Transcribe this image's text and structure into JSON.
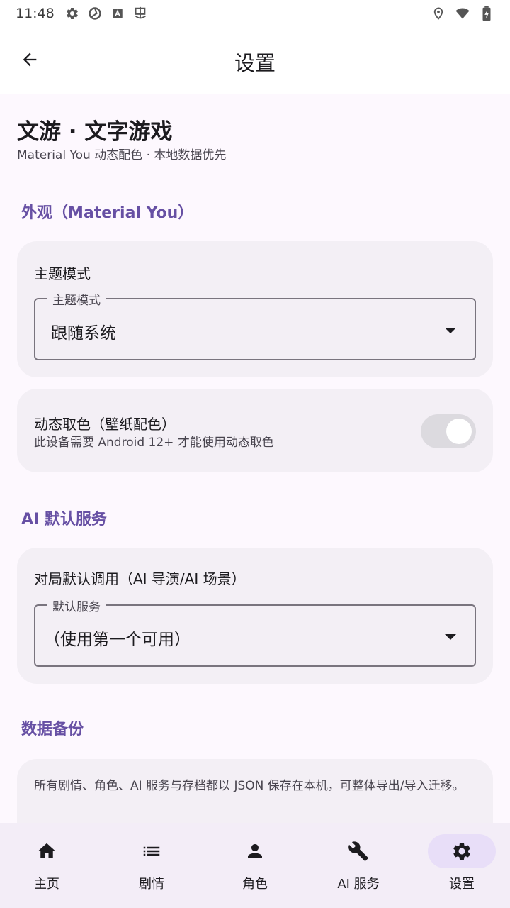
{
  "status_bar": {
    "time": "11:48",
    "left_icons": [
      "gear-icon",
      "aperture-icon",
      "a-box-icon",
      "bug-icon"
    ],
    "right_icons": [
      "location-icon",
      "wifi-icon",
      "battery-icon"
    ]
  },
  "app_bar": {
    "title": "设置"
  },
  "header": {
    "app_name": "文游 · 文字游戏",
    "subtitle": "Material You 动态配色 · 本地数据优先"
  },
  "sections": {
    "appearance": {
      "title": "外观（Material You）",
      "theme_card": {
        "label": "主题模式",
        "field_label": "主题模式",
        "value": "跟随系统"
      },
      "dynamic_card": {
        "label": "动态取色（壁纸配色）",
        "desc": "此设备需要 Android 12+ 才能使用动态取色",
        "enabled": false
      }
    },
    "ai": {
      "title": "AI 默认服务",
      "card": {
        "label": "对局默认调用（AI 导演/AI 场景）",
        "field_label": "默认服务",
        "value": "（使用第一个可用）"
      }
    },
    "backup": {
      "title": "数据备份",
      "desc": "所有剧情、角色、AI 服务与存档都以 JSON 保存在本机，可整体导出/导入迁移。"
    }
  },
  "bottom_nav": {
    "items": [
      {
        "label": "主页",
        "icon": "home-icon"
      },
      {
        "label": "剧情",
        "icon": "list-icon"
      },
      {
        "label": "角色",
        "icon": "person-icon"
      },
      {
        "label": "AI 服务",
        "icon": "wrench-icon"
      },
      {
        "label": "设置",
        "icon": "gear-icon"
      }
    ],
    "active": "设置"
  },
  "colors": {
    "accent": "#6750a4",
    "background": "#fdf8fe",
    "card": "#f3eff5",
    "nav_active": "#e8def8"
  }
}
